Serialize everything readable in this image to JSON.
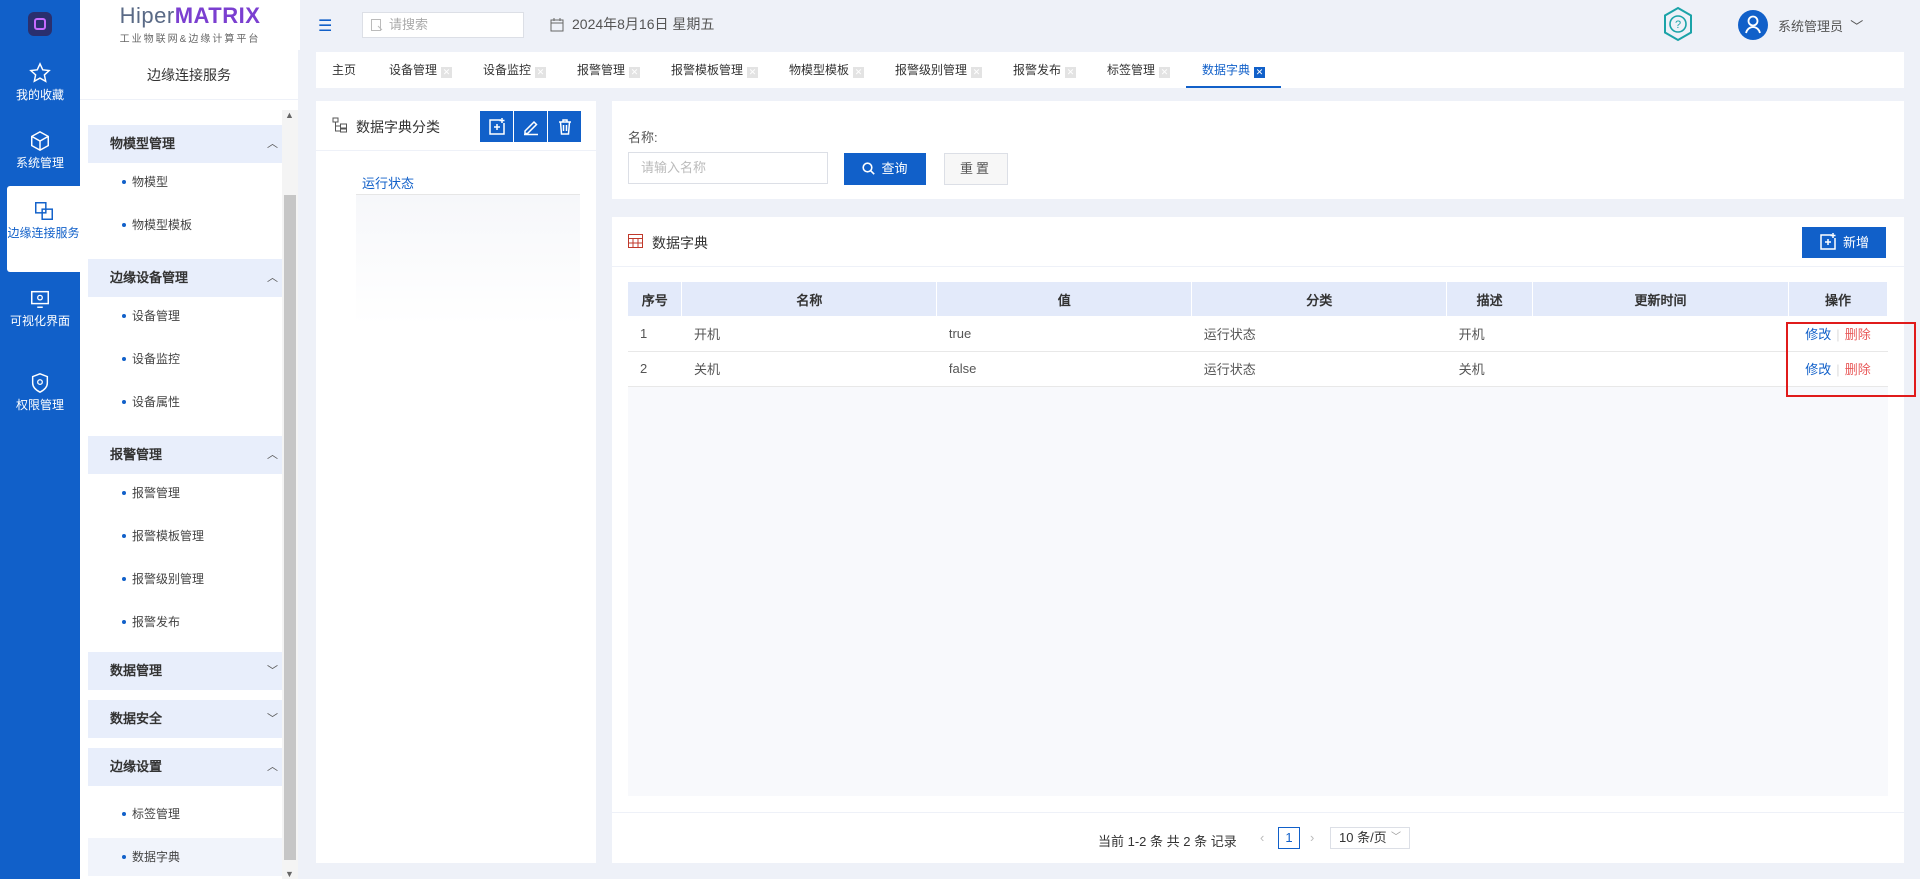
{
  "brand": {
    "prefix": "Hiper",
    "highlight": "MATRIX",
    "subtitle": "工业物联网&边缘计算平台"
  },
  "rail": [
    {
      "label": "我的收藏",
      "icon": "star-icon"
    },
    {
      "label": "系统管理",
      "icon": "cube-icon"
    },
    {
      "label": "边缘连接服务",
      "icon": "connect-icon"
    },
    {
      "label": "可视化界面",
      "icon": "monitor-icon"
    },
    {
      "label": "权限管理",
      "icon": "shield-icon"
    }
  ],
  "sidebar": {
    "title": "边缘连接服务",
    "groups": [
      {
        "label": "物模型管理",
        "items": [
          "物模型",
          "物模型模板"
        ]
      },
      {
        "label": "边缘设备管理",
        "items": [
          "设备管理",
          "设备监控",
          "设备属性"
        ]
      },
      {
        "label": "报警管理",
        "items": [
          "报警管理",
          "报警模板管理",
          "报警级别管理",
          "报警发布"
        ]
      },
      {
        "label": "数据管理",
        "items": []
      },
      {
        "label": "数据安全",
        "items": []
      },
      {
        "label": "边缘设置",
        "items": [
          "标签管理",
          "数据字典"
        ]
      }
    ]
  },
  "topbar": {
    "search_placeholder": "请搜索",
    "date": "2024年8月16日 星期五",
    "user": "系统管理员"
  },
  "tabs": [
    "主页",
    "设备管理",
    "设备监控",
    "报警管理",
    "报警模板管理",
    "物模型模板",
    "报警级别管理",
    "报警发布",
    "标签管理",
    "数据字典"
  ],
  "category": {
    "title": "数据字典分类",
    "node": "运行状态"
  },
  "query": {
    "label": "名称:",
    "placeholder": "请输入名称",
    "search_btn": "查询",
    "reset_btn": "重置"
  },
  "table": {
    "title": "数据字典",
    "add_btn": "新增",
    "headers": [
      "序号",
      "名称",
      "值",
      "分类",
      "描述",
      "更新时间",
      "操作"
    ],
    "rows": [
      {
        "index": "1",
        "name": "开机",
        "value": "true",
        "category": "运行状态",
        "desc": "开机",
        "updated": ""
      },
      {
        "index": "2",
        "name": "关机",
        "value": "false",
        "category": "运行状态",
        "desc": "关机",
        "updated": ""
      }
    ],
    "edit_label": "修改",
    "delete_label": "删除"
  },
  "pagination": {
    "info": "当前 1-2 条 共 2 条 记录",
    "page": "1",
    "page_size": "10 条/页"
  },
  "colors": {
    "primary": "#1160c9",
    "danger": "#e85a5a",
    "highlight": "#e01b1b"
  }
}
